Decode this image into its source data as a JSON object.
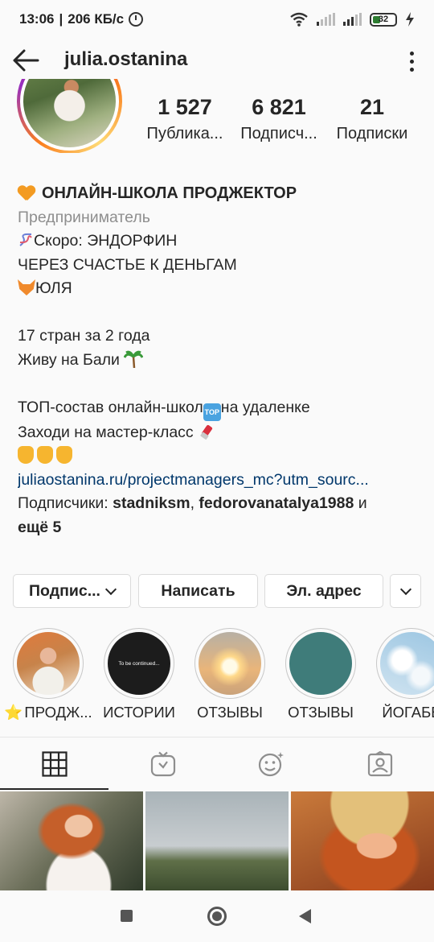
{
  "status_bar": {
    "time": "13:06",
    "speed": "206 КБ/с",
    "battery": "32",
    "icons": [
      "alarm-icon",
      "wifi-icon",
      "signal-icon",
      "battery-icon",
      "charging-icon"
    ]
  },
  "header": {
    "username": "julia.ostanina",
    "back_icon": "arrow-left-icon",
    "menu_icon": "more-vertical-icon"
  },
  "stats": [
    {
      "value": "1 527",
      "label": "Публика..."
    },
    {
      "value": "6 821",
      "label": "Подписч..."
    },
    {
      "value": "21",
      "label": "Подписки"
    }
  ],
  "bio": {
    "name": "ОНЛАЙН-ШКОЛА ПРОДЖЕКТОР",
    "category": "Предприниматель",
    "line1": "Скоро: ЭНДОРФИН",
    "line2": "ЧЕРЕЗ СЧАСТЬЕ К ДЕНЬГАМ",
    "line3": "ЮЛЯ",
    "line4": "17 стран за 2 года",
    "line5": "Живу на Бали",
    "line6a": "ТОП-состав онлайн-школ",
    "line6_badge": "TOP",
    "line6b": "на удаленке",
    "line7": "Заходи на мастер-класс",
    "link": "juliaostanina.ru/projectmanagers_mc?utm_sourc...",
    "followers_prefix": "Подписчики: ",
    "follower1": "stadniksm",
    "sep": ", ",
    "follower2": "fedorovanatalya1988",
    "and": " и",
    "more": "ещё 5"
  },
  "buttons": {
    "following": "Подпис...",
    "message": "Написать",
    "email": "Эл. адрес"
  },
  "highlights": [
    {
      "label": "ПРОДЖ...",
      "star": "⭐"
    },
    {
      "label": "ИСТОРИИ",
      "caption": "To be continued..."
    },
    {
      "label": "ОТЗЫВЫ"
    },
    {
      "label": "ОТЗЫВЫ"
    },
    {
      "label": "ЙОГАБЕ"
    }
  ],
  "tabs": [
    "grid-icon",
    "igtv-icon",
    "reels-effects-icon",
    "tagged-icon"
  ],
  "colors": {
    "link": "#00376b",
    "category": "#8e8e8e",
    "ring_start": "#d62976",
    "ring_end": "#feda75"
  }
}
